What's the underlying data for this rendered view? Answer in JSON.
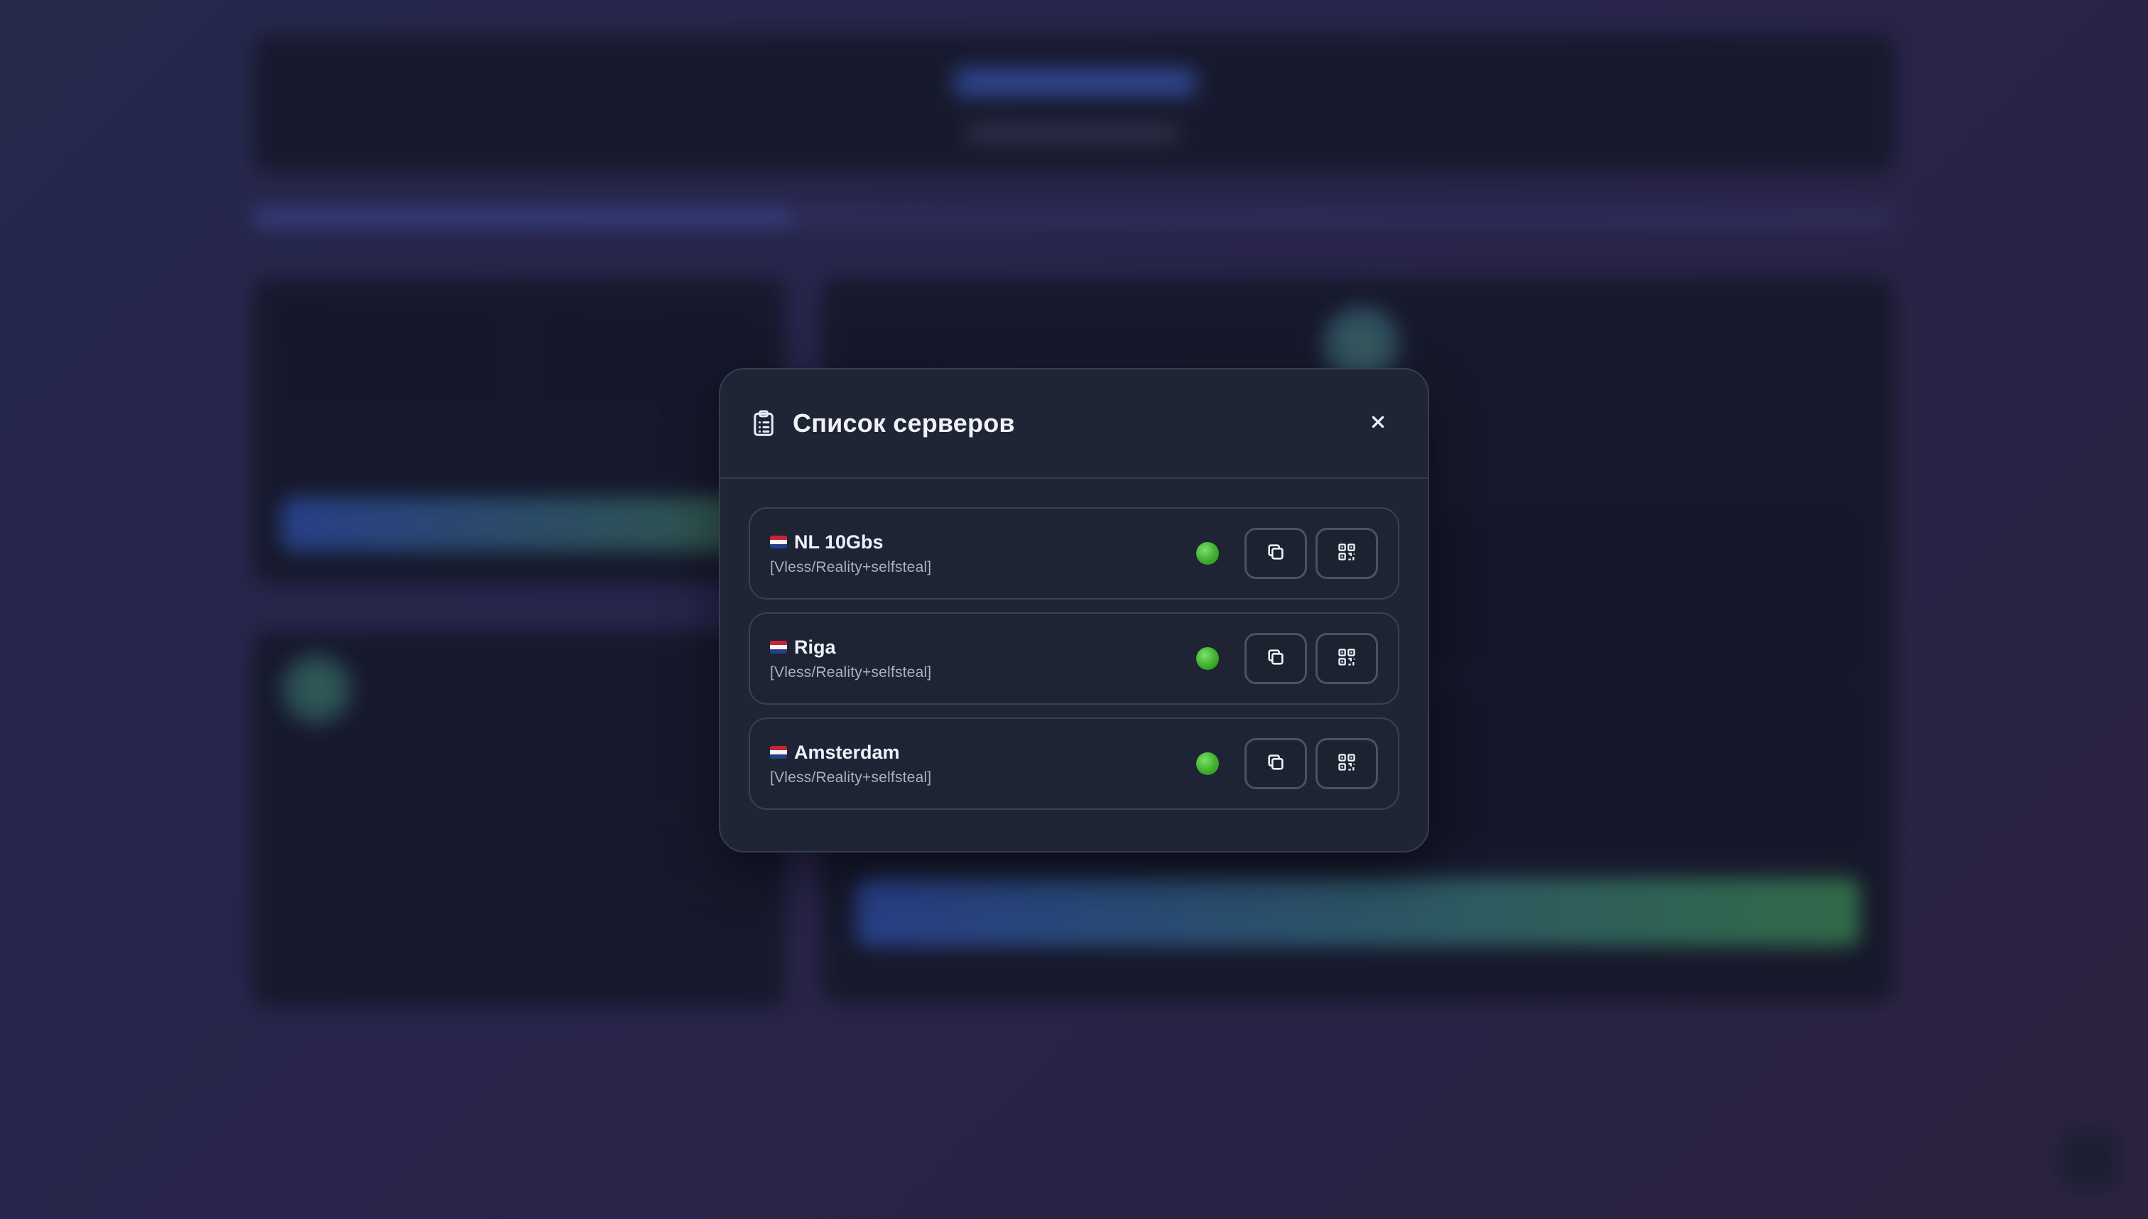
{
  "modal": {
    "title": "Список серверов",
    "close_label": "×"
  },
  "servers": [
    {
      "name": "NL 10Gbs",
      "protocol": "[Vless/Reality+selfsteal]",
      "flag": "netherlands-flag",
      "status": "online"
    },
    {
      "name": "Riga",
      "protocol": "[Vless/Reality+selfsteal]",
      "flag": "netherlands-flag",
      "status": "online"
    },
    {
      "name": "Amsterdam",
      "protocol": "[Vless/Reality+selfsteal]",
      "flag": "netherlands-flag",
      "status": "online"
    }
  ],
  "icons": {
    "header": "clipboard-list-icon",
    "copy": "copy-icon",
    "qr": "qr-code-icon",
    "status": "status-online-dot"
  },
  "colors": {
    "modal_bg": "#1f2535",
    "row_border": "#3a4157",
    "status_online": "#3fae2e",
    "text_primary": "#eef1f7",
    "text_secondary": "#a9b0c3"
  }
}
